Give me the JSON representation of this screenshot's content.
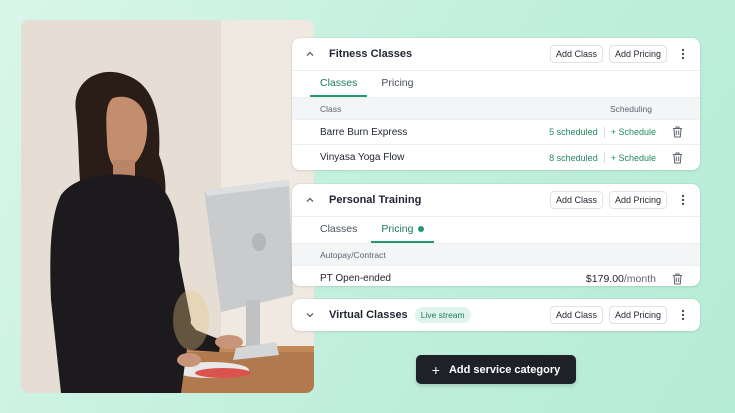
{
  "photo": {
    "alt_description_icon": "woman-at-computer-photo"
  },
  "categories": [
    {
      "title": "Fitness Classes",
      "add_class_label": "Add Class",
      "add_pricing_label": "Add Pricing",
      "tabs": [
        {
          "label": "Classes",
          "active": true
        },
        {
          "label": "Pricing",
          "active": false
        }
      ],
      "columns": {
        "class": "Class",
        "scheduling": "Scheduling"
      },
      "rows": [
        {
          "name": "Barre Burn Express",
          "scheduled": "5 scheduled",
          "schedule_link": "+ Schedule"
        },
        {
          "name": "Vinyasa Yoga Flow",
          "scheduled": "8 scheduled",
          "schedule_link": "+ Schedule"
        }
      ]
    },
    {
      "title": "Personal Training",
      "add_class_label": "Add Class",
      "add_pricing_label": "Add Pricing",
      "tabs": [
        {
          "label": "Classes",
          "active": false
        },
        {
          "label": "Pricing",
          "active": true
        }
      ],
      "columns": {
        "type": "Autopay/Contract"
      },
      "rows": [
        {
          "name": "PT Open-ended",
          "price": "$179.00",
          "unit": "/month"
        }
      ]
    },
    {
      "title": "Virtual Classes",
      "badge": "Live stream",
      "add_class_label": "Add Class",
      "add_pricing_label": "Add Pricing"
    }
  ],
  "add_category_label": "Add service category",
  "colors": {
    "accent": "#1f9b6d",
    "accent_text": "#1f8a5f",
    "dark_button": "#1e2228",
    "background": "#c4f0de"
  }
}
